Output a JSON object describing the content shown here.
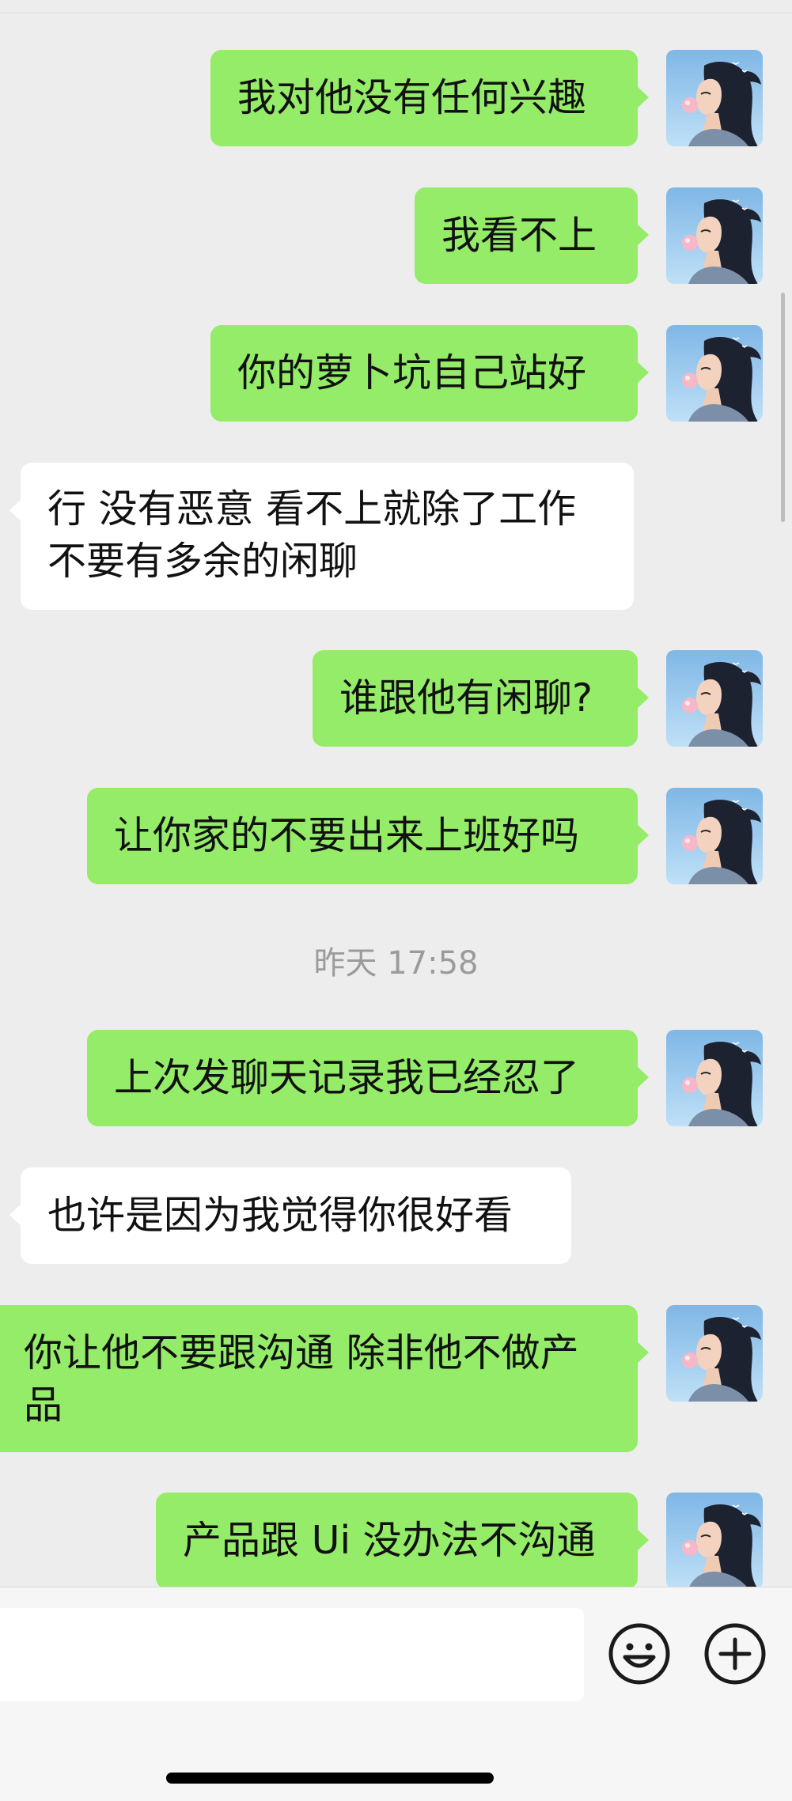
{
  "conversation": {
    "messages": [
      {
        "direction": "out",
        "text": "我对他没有任何兴趣"
      },
      {
        "direction": "out",
        "text": "我看不上"
      },
      {
        "direction": "out",
        "text": "你的萝卜坑自己站好"
      },
      {
        "direction": "in",
        "text": "行 没有恶意 看不上就除了工作\n不要有多余的闲聊"
      },
      {
        "direction": "out",
        "text": "谁跟他有闲聊?"
      },
      {
        "direction": "out",
        "text": "让你家的不要出来上班好吗"
      },
      {
        "direction": "out",
        "text": "上次发聊天记录我已经忍了"
      },
      {
        "direction": "in",
        "text": "也许是因为我觉得你很好看"
      },
      {
        "direction": "out",
        "text": "你让他不要跟沟通 除非他不做产\n品"
      },
      {
        "direction": "out",
        "text": "产品跟 Ui 没办法不沟通"
      }
    ],
    "timestamp": "昨天 17:58"
  },
  "input_bar": {
    "emoji_icon": "emoji-icon",
    "add_icon": "plus-circle-icon"
  },
  "colors": {
    "outgoing_bubble": "#95ec69",
    "incoming_bubble": "#ffffff",
    "background": "#ededed"
  }
}
